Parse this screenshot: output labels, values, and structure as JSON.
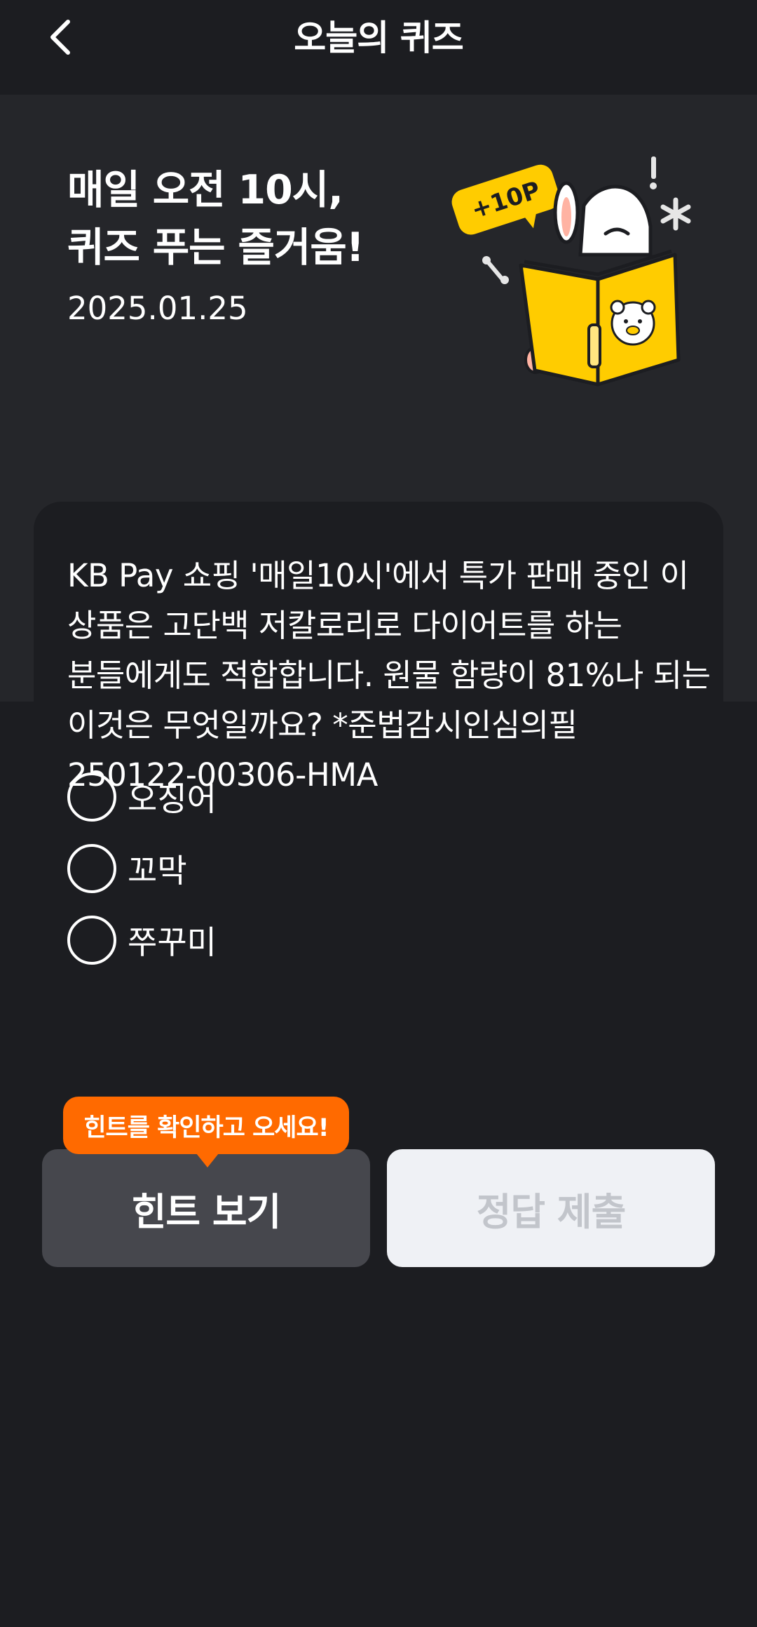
{
  "header": {
    "title": "오늘의 퀴즈",
    "back_icon": "chevron-left-icon"
  },
  "hero": {
    "heading_line1": "매일 오전 10시,",
    "heading_line2": "퀴즈 푸는 즐거움!",
    "date": "2025.01.25",
    "badge": "+10P"
  },
  "question": {
    "text": "KB Pay 쇼핑 '매일10시'에서 특가 판매 중인 이 상품은 고단백 저칼로리로 다이어트를 하는 분들에게도 적합합니다. 원물 함량이 81%나 되는 이것은 무엇일까요? *준법감시인심의필 250122-00306-HMA"
  },
  "options": [
    {
      "label": "오징어"
    },
    {
      "label": "꼬막"
    },
    {
      "label": "쭈꾸미"
    }
  ],
  "tooltip": {
    "text": "힌트를 확인하고 오세요!"
  },
  "buttons": {
    "hint_label": "힌트 보기",
    "submit_label": "정답 제출"
  },
  "colors": {
    "background": "#1c1d21",
    "hero_background": "#25262a",
    "accent_orange": "#ff6a00",
    "mascot_yellow": "#ffcc00",
    "hint_button": "#46474d",
    "submit_button": "#eff1f5"
  }
}
